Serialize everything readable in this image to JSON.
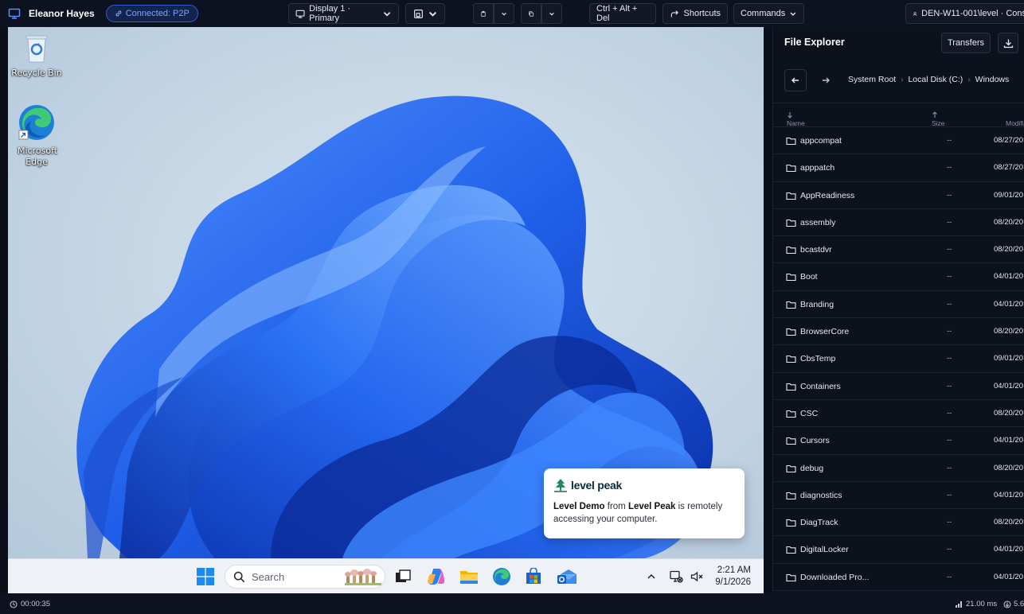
{
  "session": {
    "user_name": "Eleanor Hayes",
    "connection_badge": "Connected: P2P"
  },
  "toolbar": {
    "display_label": "Display 1 · Primary",
    "ctrl_alt_del_label": "Ctrl + Alt + Del",
    "shortcuts_label": "Shortcuts",
    "commands_label": "Commands",
    "device_label": "DEN-W11-001\\level · Cons"
  },
  "desktop": {
    "icons": [
      {
        "label": "Recycle Bin",
        "icon": "recycle-bin-icon"
      },
      {
        "label": "Microsoft Edge",
        "icon": "edge-icon"
      }
    ],
    "taskbar": {
      "search_placeholder": "Search",
      "time": "2:21 AM",
      "date": "9/1/2026"
    },
    "notification": {
      "brand": "level peak",
      "msg_part1": "Level Demo",
      "msg_part2": " from ",
      "msg_part3": "Level Peak",
      "msg_part4": " is remotely accessing your computer."
    }
  },
  "file_explorer": {
    "title": "File Explorer",
    "transfers_label": "Transfers",
    "breadcrumbs": [
      "System Root",
      "Local Disk (C:)",
      "Windows"
    ],
    "columns": {
      "name": "Name",
      "size": "Size",
      "modified": "Modifi"
    },
    "rows": [
      {
        "name": "appcompat",
        "size": "--",
        "modified": "08/27/20"
      },
      {
        "name": "apppatch",
        "size": "--",
        "modified": "08/27/20"
      },
      {
        "name": "AppReadiness",
        "size": "--",
        "modified": "09/01/20"
      },
      {
        "name": "assembly",
        "size": "--",
        "modified": "08/20/20"
      },
      {
        "name": "bcastdvr",
        "size": "--",
        "modified": "08/20/20"
      },
      {
        "name": "Boot",
        "size": "--",
        "modified": "04/01/20"
      },
      {
        "name": "Branding",
        "size": "--",
        "modified": "04/01/20"
      },
      {
        "name": "BrowserCore",
        "size": "--",
        "modified": "08/20/20"
      },
      {
        "name": "CbsTemp",
        "size": "--",
        "modified": "09/01/20"
      },
      {
        "name": "Containers",
        "size": "--",
        "modified": "04/01/20"
      },
      {
        "name": "CSC",
        "size": "--",
        "modified": "08/20/20"
      },
      {
        "name": "Cursors",
        "size": "--",
        "modified": "04/01/20"
      },
      {
        "name": "debug",
        "size": "--",
        "modified": "08/20/20"
      },
      {
        "name": "diagnostics",
        "size": "--",
        "modified": "04/01/20"
      },
      {
        "name": "DiagTrack",
        "size": "--",
        "modified": "08/20/20"
      },
      {
        "name": "DigitalLocker",
        "size": "--",
        "modified": "04/01/20"
      },
      {
        "name": "Downloaded Pro...",
        "size": "--",
        "modified": "04/01/20"
      }
    ]
  },
  "status": {
    "timer": "00:00:35",
    "latency": "21.00 ms",
    "extra": "5.6"
  },
  "colors": {
    "accent": "#5b8cff",
    "panel_bg": "#0c111c",
    "toolbar_bg": "#0d1220"
  }
}
